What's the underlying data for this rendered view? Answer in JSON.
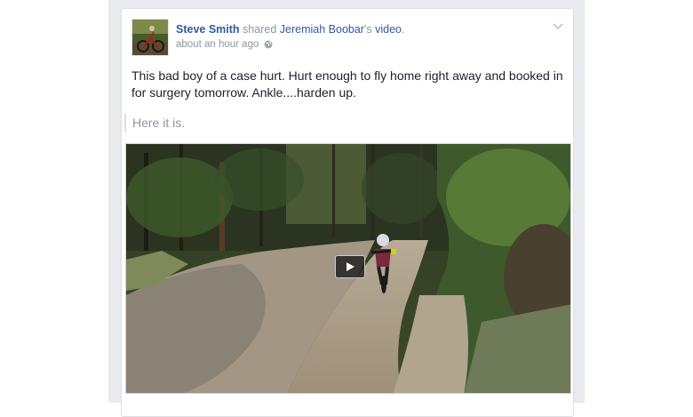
{
  "story": {
    "author": "Steve Smith",
    "action": "shared",
    "shared_owner": "Jeremiah Boobar",
    "possessive": "'s",
    "shared_object": "video",
    "period": ".",
    "timestamp": "about an hour ago",
    "privacy_icon": "globe-icon",
    "options_icon": "chevron-down-icon",
    "message": "This bad boy of a case hurt. Hurt enough to fly home right away and booked in for surgery tomorrow. Ankle....harden up.",
    "quote": "Here it is.",
    "video": {
      "play_icon": "play-icon"
    }
  },
  "colors": {
    "feed_background": "#e9eaed",
    "link": "#365899",
    "meta_text": "#90949c",
    "body_text": "#1d2129"
  }
}
